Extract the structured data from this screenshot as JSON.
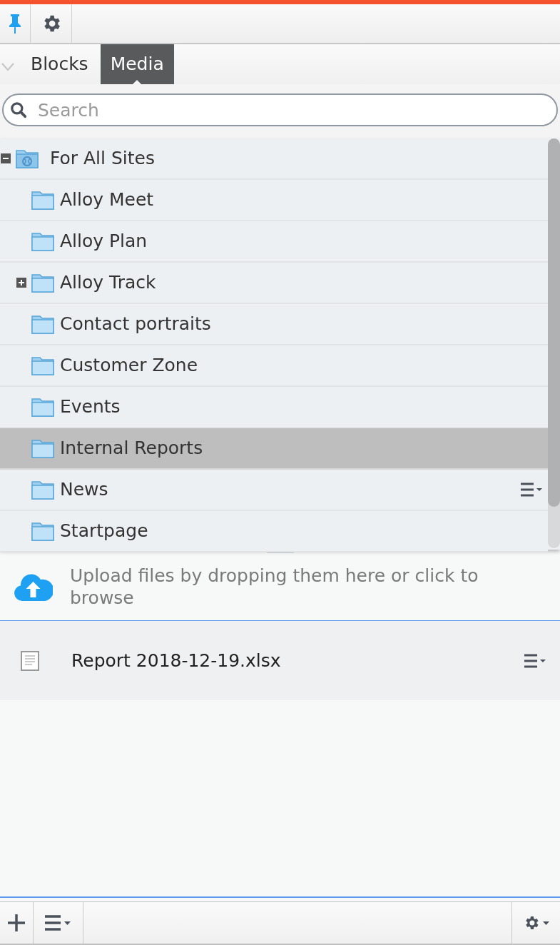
{
  "tabs": [
    {
      "label": "Blocks",
      "selected": false
    },
    {
      "label": "Media",
      "selected": true
    }
  ],
  "search": {
    "placeholder": "Search"
  },
  "tree": [
    {
      "label": "For All Sites",
      "kind": "site",
      "expanded": true,
      "selected": false,
      "hovered": false,
      "children": [
        {
          "label": "Alloy Meet",
          "selected": false,
          "hovered": false
        },
        {
          "label": "Alloy Plan",
          "selected": false,
          "hovered": false
        },
        {
          "label": "Alloy Track",
          "expanded": false,
          "selected": false,
          "hovered": false
        },
        {
          "label": "Contact portraits",
          "selected": false,
          "hovered": false
        },
        {
          "label": "Customer Zone",
          "selected": false,
          "hovered": false
        },
        {
          "label": "Events",
          "selected": false,
          "hovered": false
        },
        {
          "label": "Internal Reports",
          "selected": true,
          "hovered": false
        },
        {
          "label": "News",
          "selected": false,
          "hovered": true
        },
        {
          "label": "Startpage",
          "selected": false,
          "hovered": false
        }
      ]
    }
  ],
  "upload": {
    "text": "Upload files by dropping them here or click to browse"
  },
  "files": [
    {
      "name": "Report 2018-12-19.xlsx"
    }
  ]
}
